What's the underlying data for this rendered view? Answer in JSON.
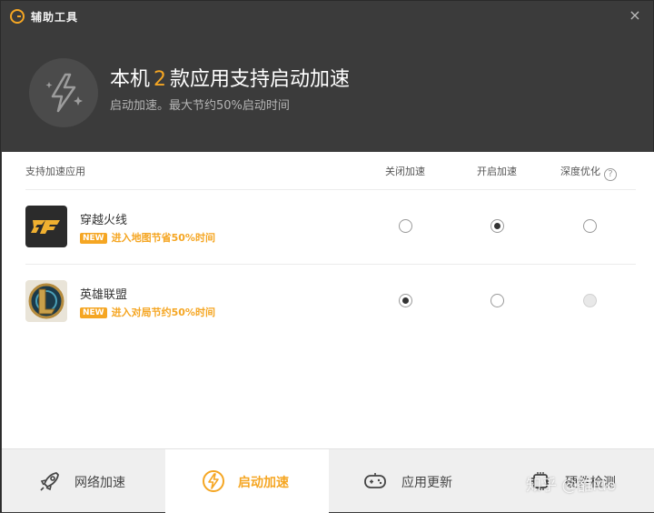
{
  "window": {
    "title": "辅助工具",
    "close_glyph": "×",
    "logo_icon": "g-logo-icon"
  },
  "header": {
    "title_prefix": "本机",
    "title_count": "2",
    "title_suffix": "款应用支持启动加速",
    "subtitle": "启动加速。最大节约50%启动时间",
    "icon": "lightning-sparkle-icon"
  },
  "table": {
    "columns": {
      "app": "支持加速应用",
      "off": "关闭加速",
      "on": "开启加速",
      "deep": "深度优化"
    },
    "help_glyph": "?",
    "rows": [
      {
        "name": "穿越火线",
        "badge": "NEW",
        "tip": "进入地图节省50%时间",
        "selected": "on",
        "deep_disabled": false
      },
      {
        "name": "英雄联盟",
        "badge": "NEW",
        "tip": "进入对局节约50%时间",
        "selected": "off",
        "deep_disabled": true
      }
    ]
  },
  "tabs": [
    {
      "label": "网络加速",
      "icon": "rocket-icon",
      "active": false
    },
    {
      "label": "启动加速",
      "icon": "lightning-icon",
      "active": true
    },
    {
      "label": "应用更新",
      "icon": "gamepad-icon",
      "active": false
    },
    {
      "label": "硬件检测",
      "icon": "chip-icon",
      "active": false
    }
  ],
  "watermark": "知乎 @雒luo",
  "colors": {
    "accent": "#f5a623",
    "header_bg": "#3b3b3b",
    "content_bg": "#ffffff",
    "tabbar_bg": "#efefef"
  }
}
